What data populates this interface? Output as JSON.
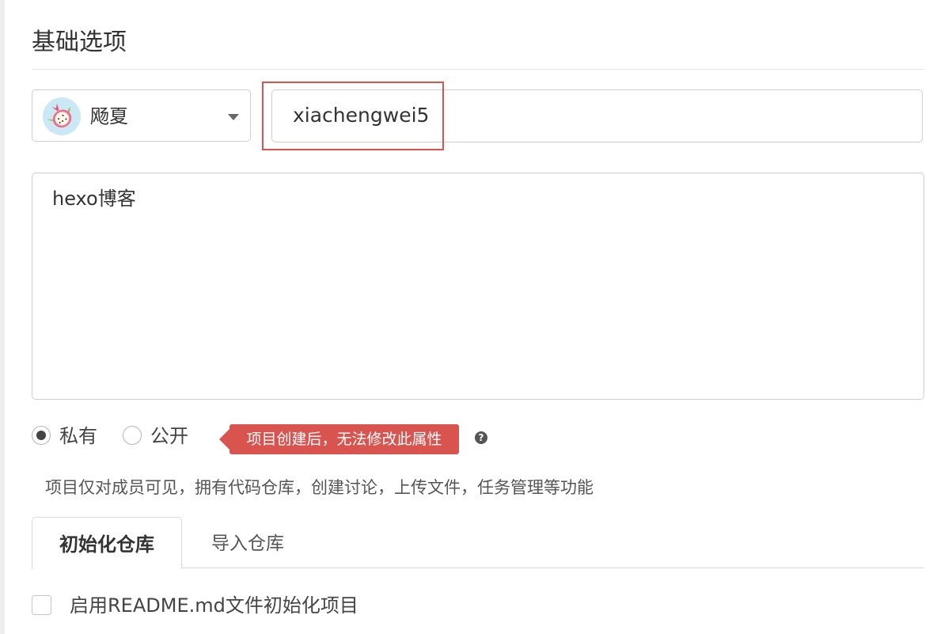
{
  "section": {
    "title": "基础选项"
  },
  "owner": {
    "name": "飏夏",
    "avatar_icon": "dragonfruit-avatar"
  },
  "project_name": {
    "value": "xiachengwei5"
  },
  "description": {
    "value": "hexo博客"
  },
  "visibility": {
    "options": [
      {
        "label": "私有",
        "checked": true
      },
      {
        "label": "公开",
        "checked": false
      }
    ],
    "warning": "项目创建后，无法修改此属性",
    "help_icon": "?",
    "hint": "项目仅对成员可见，拥有代码仓库，创建讨论，上传文件，任务管理等功能"
  },
  "tabs": [
    {
      "label": "初始化仓库",
      "active": true
    },
    {
      "label": "导入仓库",
      "active": false
    }
  ],
  "readme": {
    "label": "启用README.md文件初始化项目",
    "checked": false
  },
  "colors": {
    "accent_red": "#d9534f",
    "border": "#cfcfcf",
    "avatar_bg": "#cbe8f5"
  }
}
